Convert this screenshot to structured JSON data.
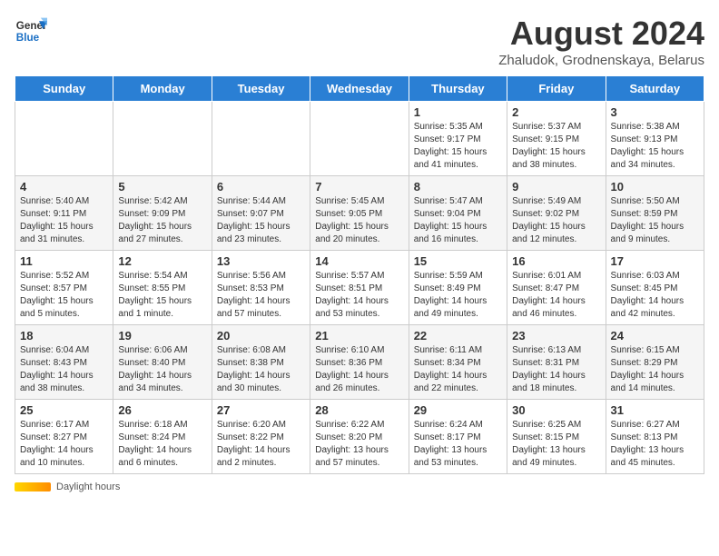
{
  "header": {
    "logo_line1": "General",
    "logo_line2": "Blue",
    "title": "August 2024",
    "subtitle": "Zhaludok, Grodnenskaya, Belarus"
  },
  "days_of_week": [
    "Sunday",
    "Monday",
    "Tuesday",
    "Wednesday",
    "Thursday",
    "Friday",
    "Saturday"
  ],
  "weeks": [
    [
      {
        "day": "",
        "info": ""
      },
      {
        "day": "",
        "info": ""
      },
      {
        "day": "",
        "info": ""
      },
      {
        "day": "",
        "info": ""
      },
      {
        "day": "1",
        "info": "Sunrise: 5:35 AM\nSunset: 9:17 PM\nDaylight: 15 hours\nand 41 minutes."
      },
      {
        "day": "2",
        "info": "Sunrise: 5:37 AM\nSunset: 9:15 PM\nDaylight: 15 hours\nand 38 minutes."
      },
      {
        "day": "3",
        "info": "Sunrise: 5:38 AM\nSunset: 9:13 PM\nDaylight: 15 hours\nand 34 minutes."
      }
    ],
    [
      {
        "day": "4",
        "info": "Sunrise: 5:40 AM\nSunset: 9:11 PM\nDaylight: 15 hours\nand 31 minutes."
      },
      {
        "day": "5",
        "info": "Sunrise: 5:42 AM\nSunset: 9:09 PM\nDaylight: 15 hours\nand 27 minutes."
      },
      {
        "day": "6",
        "info": "Sunrise: 5:44 AM\nSunset: 9:07 PM\nDaylight: 15 hours\nand 23 minutes."
      },
      {
        "day": "7",
        "info": "Sunrise: 5:45 AM\nSunset: 9:05 PM\nDaylight: 15 hours\nand 20 minutes."
      },
      {
        "day": "8",
        "info": "Sunrise: 5:47 AM\nSunset: 9:04 PM\nDaylight: 15 hours\nand 16 minutes."
      },
      {
        "day": "9",
        "info": "Sunrise: 5:49 AM\nSunset: 9:02 PM\nDaylight: 15 hours\nand 12 minutes."
      },
      {
        "day": "10",
        "info": "Sunrise: 5:50 AM\nSunset: 8:59 PM\nDaylight: 15 hours\nand 9 minutes."
      }
    ],
    [
      {
        "day": "11",
        "info": "Sunrise: 5:52 AM\nSunset: 8:57 PM\nDaylight: 15 hours\nand 5 minutes."
      },
      {
        "day": "12",
        "info": "Sunrise: 5:54 AM\nSunset: 8:55 PM\nDaylight: 15 hours\nand 1 minute."
      },
      {
        "day": "13",
        "info": "Sunrise: 5:56 AM\nSunset: 8:53 PM\nDaylight: 14 hours\nand 57 minutes."
      },
      {
        "day": "14",
        "info": "Sunrise: 5:57 AM\nSunset: 8:51 PM\nDaylight: 14 hours\nand 53 minutes."
      },
      {
        "day": "15",
        "info": "Sunrise: 5:59 AM\nSunset: 8:49 PM\nDaylight: 14 hours\nand 49 minutes."
      },
      {
        "day": "16",
        "info": "Sunrise: 6:01 AM\nSunset: 8:47 PM\nDaylight: 14 hours\nand 46 minutes."
      },
      {
        "day": "17",
        "info": "Sunrise: 6:03 AM\nSunset: 8:45 PM\nDaylight: 14 hours\nand 42 minutes."
      }
    ],
    [
      {
        "day": "18",
        "info": "Sunrise: 6:04 AM\nSunset: 8:43 PM\nDaylight: 14 hours\nand 38 minutes."
      },
      {
        "day": "19",
        "info": "Sunrise: 6:06 AM\nSunset: 8:40 PM\nDaylight: 14 hours\nand 34 minutes."
      },
      {
        "day": "20",
        "info": "Sunrise: 6:08 AM\nSunset: 8:38 PM\nDaylight: 14 hours\nand 30 minutes."
      },
      {
        "day": "21",
        "info": "Sunrise: 6:10 AM\nSunset: 8:36 PM\nDaylight: 14 hours\nand 26 minutes."
      },
      {
        "day": "22",
        "info": "Sunrise: 6:11 AM\nSunset: 8:34 PM\nDaylight: 14 hours\nand 22 minutes."
      },
      {
        "day": "23",
        "info": "Sunrise: 6:13 AM\nSunset: 8:31 PM\nDaylight: 14 hours\nand 18 minutes."
      },
      {
        "day": "24",
        "info": "Sunrise: 6:15 AM\nSunset: 8:29 PM\nDaylight: 14 hours\nand 14 minutes."
      }
    ],
    [
      {
        "day": "25",
        "info": "Sunrise: 6:17 AM\nSunset: 8:27 PM\nDaylight: 14 hours\nand 10 minutes."
      },
      {
        "day": "26",
        "info": "Sunrise: 6:18 AM\nSunset: 8:24 PM\nDaylight: 14 hours\nand 6 minutes."
      },
      {
        "day": "27",
        "info": "Sunrise: 6:20 AM\nSunset: 8:22 PM\nDaylight: 14 hours\nand 2 minutes."
      },
      {
        "day": "28",
        "info": "Sunrise: 6:22 AM\nSunset: 8:20 PM\nDaylight: 13 hours\nand 57 minutes."
      },
      {
        "day": "29",
        "info": "Sunrise: 6:24 AM\nSunset: 8:17 PM\nDaylight: 13 hours\nand 53 minutes."
      },
      {
        "day": "30",
        "info": "Sunrise: 6:25 AM\nSunset: 8:15 PM\nDaylight: 13 hours\nand 49 minutes."
      },
      {
        "day": "31",
        "info": "Sunrise: 6:27 AM\nSunset: 8:13 PM\nDaylight: 13 hours\nand 45 minutes."
      }
    ]
  ],
  "footer": {
    "daylight_label": "Daylight hours"
  }
}
